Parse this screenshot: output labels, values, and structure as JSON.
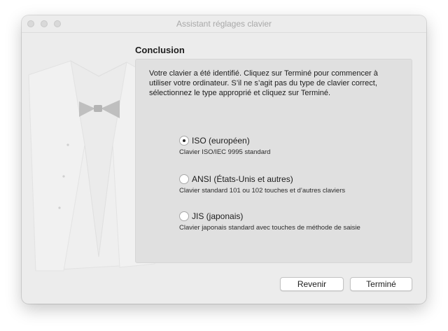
{
  "window": {
    "title": "Assistant réglages clavier"
  },
  "main": {
    "heading": "Conclusion",
    "message": "Votre clavier a été identifié. Cliquez sur Terminé pour commencer à utiliser votre ordinateur. S’il ne s’agit pas du type de clavier correct, sélectionnez le type approprié et cliquez sur Terminé.",
    "options": [
      {
        "label": "ISO (européen)",
        "description": "Clavier ISO/IEC 9995 standard",
        "selected": true
      },
      {
        "label": "ANSI (États-Unis et autres)",
        "description": "Clavier standard 101 ou 102 touches et d’autres claviers",
        "selected": false
      },
      {
        "label": "JIS (japonais)",
        "description": "Clavier japonais standard avec touches de méthode de saisie",
        "selected": false
      }
    ]
  },
  "buttons": {
    "back_label": "Revenir",
    "done_label": "Terminé"
  },
  "colors": {
    "window_bg": "#ececec",
    "panel_bg": "#e0e0e0",
    "title_text": "#a8a8a8"
  },
  "icons": [
    "close-icon",
    "minimize-icon",
    "zoom-icon",
    "tuxedo-illustration"
  ]
}
